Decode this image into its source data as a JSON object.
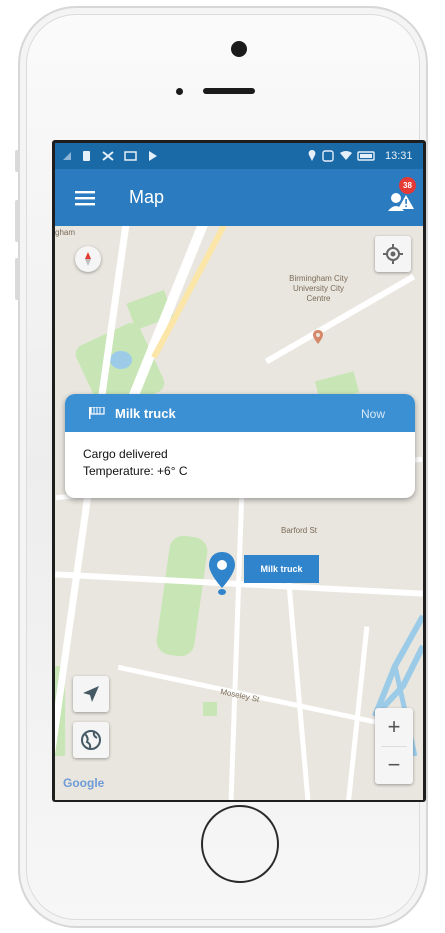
{
  "status_bar": {
    "time": "13:31"
  },
  "app_bar": {
    "title": "Map",
    "notification_count": "38"
  },
  "popup": {
    "title": "Milk truck",
    "time": "Now",
    "line1": "Cargo delivered",
    "line2": "Temperature: +6° C"
  },
  "marker": {
    "label": "Milk truck"
  },
  "map": {
    "place_label": "Birmingham City University City Centre",
    "street_label_1": "Barford St",
    "street_label_2": "Moseley St",
    "top_left_label": "gham"
  },
  "map_controls": {
    "zoom_in": "+",
    "zoom_out": "−"
  },
  "attribution": "Google",
  "colors": {
    "status_bar": "#1a6aa7",
    "app_bar": "#2b7bc0",
    "popup_header": "#3b8fd3",
    "marker": "#2f84cb",
    "badge": "#e53935"
  }
}
